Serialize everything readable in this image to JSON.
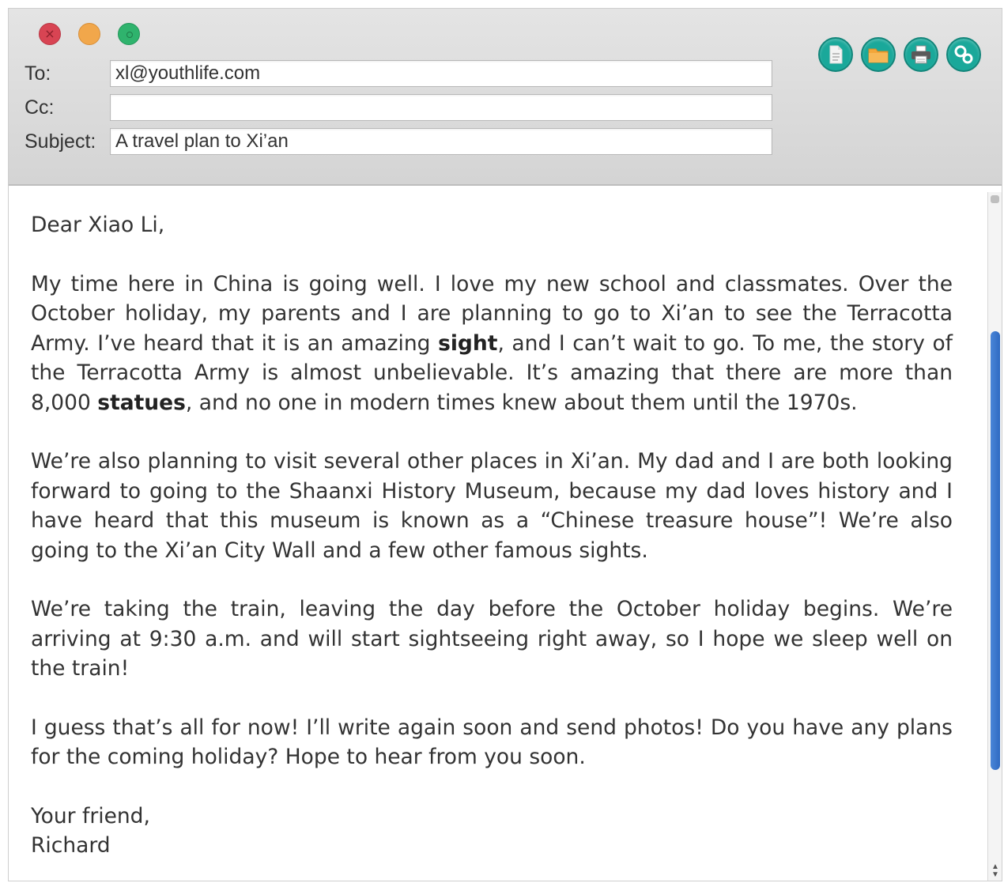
{
  "compose": {
    "to_label": "To:",
    "to_value": "xl@youthlife.com",
    "cc_label": "Cc:",
    "cc_value": "",
    "subject_label": "Subject:",
    "subject_value": "A travel plan to Xi’an"
  },
  "toolbar_icons": [
    "document-icon",
    "folder-icon",
    "printer-icon",
    "settings-icon"
  ],
  "colors": {
    "close": "#d84453",
    "minimize": "#f1a74b",
    "maximize": "#2fb36d",
    "toolbar": "#1aa89a",
    "scroll_thumb": "#3b78cf"
  },
  "letter": {
    "greeting": "Dear Xiao Li,",
    "p1": {
      "a": "My time here in China is going well. I love my new school and classmates. Over the October holiday, my parents and I are planning to go to Xi’an to see the Terracotta Army. I’ve heard that it is an amazing ",
      "b1": "sight",
      "c": ", and I can’t wait to go. To me, the story of the Terracotta Army is almost unbelievable. It’s amazing that there are more than 8,000 ",
      "b2": "statues",
      "d": ", and no one in modern times knew about them until the 1970s."
    },
    "p2": "We’re also planning to visit several other places in Xi’an. My dad and I are both looking forward to going to the Shaanxi History Museum, because my dad loves history and I have heard that this museum is known as a “Chinese treasure house”! We’re also going to the Xi’an City Wall and a few other famous sights.",
    "p3": "We’re taking the train, leaving the day before the October holiday begins. We’re arriving at 9:30 a.m. and will start sightseeing right away, so I hope we sleep well on the train!",
    "p4": "I guess that’s all for now! I’ll write again soon and send photos! Do you have any plans for the coming holiday? Hope to hear from you soon.",
    "closing": "Your friend,",
    "signature": "Richard"
  }
}
